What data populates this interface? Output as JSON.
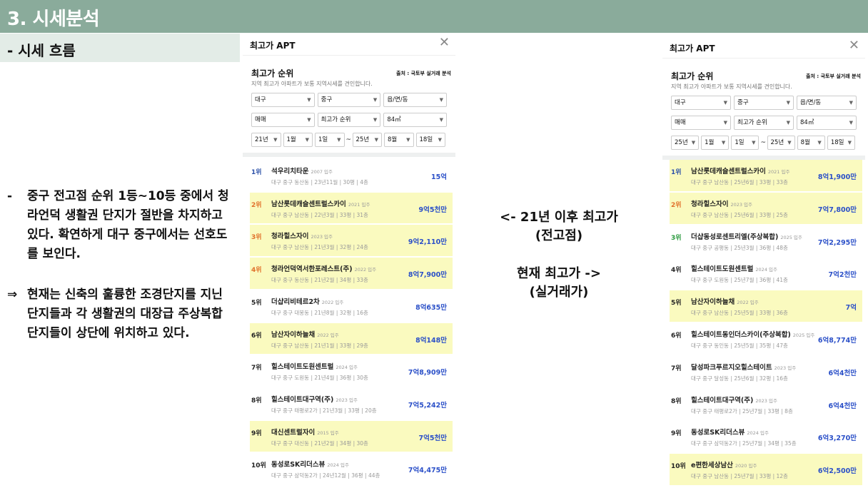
{
  "title": "3. 시세분석",
  "subtitle": "- 시세 흐름",
  "notes": [
    {
      "bullet": "-",
      "text": "중구 전고점 순위 1등~10등 중에서 청라언덕 생활권 단지가 절반을 차지하고 있다. 확연하게 대구 중구에서는 선호도를 보인다."
    },
    {
      "bullet": "⇒",
      "text": "현재는 신축의 훌륭한 조경단지를 지닌 단지들과 각 생활권의 대장급 주상복합 단지들이 상단에 위치하고 있다."
    }
  ],
  "middle": {
    "line1": "<- 21년 이후 최고가",
    "line2": "(전고점)",
    "line3": "현재 최고가 ->",
    "line4": "(실거래가)"
  },
  "panels": [
    {
      "title": "최고가 APT",
      "rank_title": "최고가 순위",
      "source": "출처 : 국토부 실거래 분석",
      "desc": "지역 최고가 아파트가 보통 지역시세를 견인합니다.",
      "filters": {
        "city": "대구",
        "district": "중구",
        "dong": "읍/면/동",
        "deal": "매매",
        "sort": "최고가 순위",
        "size": "84㎡",
        "from_year": "21년",
        "from_month": "1월",
        "from_day": "1일",
        "to_year": "25년",
        "to_month": "8월",
        "to_day": "18일"
      },
      "rows": [
        {
          "rank": "1위",
          "name": "석우리치타운",
          "year": "2007 입주",
          "info": "대구 중구 동산동 | 23년11월 | 30평 | 4층",
          "price": "15억",
          "hl": false
        },
        {
          "rank": "2위",
          "name": "남산롯데캐슬센트럴스카이",
          "year": "2021 입주",
          "info": "대구 중구 남산동 | 22년3월 | 33평 | 31층",
          "price": "9억5천만",
          "hl": true
        },
        {
          "rank": "3위",
          "name": "청라힐스자이",
          "year": "2023 입주",
          "info": "대구 중구 남산동 | 21년3월 | 32평 | 24층",
          "price": "9억2,110만",
          "hl": true
        },
        {
          "rank": "4위",
          "name": "청라언덕역서한포레스트(주)",
          "year": "2022 입주",
          "info": "대구 중구 동산동 | 21년2월 | 34평 | 33층",
          "price": "8억7,900만",
          "hl": true
        },
        {
          "rank": "5위",
          "name": "더샵리비테르2차",
          "year": "2022 입주",
          "info": "대구 중구 대봉동 | 21년8월 | 32평 | 16층",
          "price": "8억635만",
          "hl": false
        },
        {
          "rank": "6위",
          "name": "남산자이하늘채",
          "year": "2022 입주",
          "info": "대구 중구 남산동 | 21년1월 | 33평 | 29층",
          "price": "8억148만",
          "hl": true
        },
        {
          "rank": "7위",
          "name": "힐스테이트도원센트럴",
          "year": "2024 입주",
          "info": "대구 중구 도원동 | 21년4월 | 36평 | 30층",
          "price": "7억8,909만",
          "hl": false
        },
        {
          "rank": "8위",
          "name": "힐스테이트대구역(주)",
          "year": "2023 입주",
          "info": "대구 중구 태평로2가 | 21년3월 | 33평 | 20층",
          "price": "7억5,242만",
          "hl": false
        },
        {
          "rank": "9위",
          "name": "대신센트럴자이",
          "year": "2015 입주",
          "info": "대구 중구 대신동 | 21년2월 | 34평 | 30층",
          "price": "7억5천만",
          "hl": true
        },
        {
          "rank": "10위",
          "name": "동성로SK리더스뷰",
          "year": "2024 입주",
          "info": "대구 중구 삼덕동2가 | 24년12월 | 36평 | 44층",
          "price": "7억4,475만",
          "hl": false
        }
      ]
    },
    {
      "title": "최고가 APT",
      "rank_title": "최고가 순위",
      "source": "출처 : 국토부 실거래 분석",
      "desc": "지역 최고가 아파트가 보통 지역시세를 견인합니다.",
      "filters": {
        "city": "대구",
        "district": "중구",
        "dong": "읍/면/동",
        "deal": "매매",
        "sort": "최고가 순위",
        "size": "84㎡",
        "from_year": "25년",
        "from_month": "1월",
        "from_day": "1일",
        "to_year": "25년",
        "to_month": "8월",
        "to_day": "18일"
      },
      "rows": [
        {
          "rank": "1위",
          "name": "남산롯데캐슬센트럴스카이",
          "year": "2021 입주",
          "info": "대구 중구 남산동 | 25년6월 | 33평 | 33층",
          "price": "8억1,900만",
          "hl": true
        },
        {
          "rank": "2위",
          "name": "청라힐스자이",
          "year": "2023 입주",
          "info": "대구 중구 남산동 | 25년6월 | 33평 | 25층",
          "price": "7억7,800만",
          "hl": true
        },
        {
          "rank": "3위",
          "name": "더샵동성로센트리엘(주상복합)",
          "year": "2025 입주",
          "info": "대구 중구 공평동 | 25년3월 | 36평 | 48층",
          "price": "7억2,295만",
          "hl": false
        },
        {
          "rank": "4위",
          "name": "힐스테이트도원센트럴",
          "year": "2024 입주",
          "info": "대구 중구 도원동 | 25년7월 | 36평 | 41층",
          "price": "7억2천만",
          "hl": false
        },
        {
          "rank": "5위",
          "name": "남산자이하늘채",
          "year": "2022 입주",
          "info": "대구 중구 남산동 | 25년5월 | 33평 | 36층",
          "price": "7억",
          "hl": true
        },
        {
          "rank": "6위",
          "name": "힐스테이트동인더스카이(주상복합)",
          "year": "2025 입주",
          "info": "대구 중구 동인동 | 25년5월 | 35평 | 47층",
          "price": "6억8,774만",
          "hl": false
        },
        {
          "rank": "7위",
          "name": "달성파크푸르지오힐스테이트",
          "year": "2023 입주",
          "info": "대구 중구 달성동 | 25년6월 | 32평 | 16층",
          "price": "6억4천만",
          "hl": false
        },
        {
          "rank": "8위",
          "name": "힐스테이트대구역(주)",
          "year": "2023 입주",
          "info": "대구 중구 태평로2가 | 25년7월 | 33평 | 8층",
          "price": "6억4천만",
          "hl": false
        },
        {
          "rank": "9위",
          "name": "동성로SK리더스뷰",
          "year": "2024 입주",
          "info": "대구 중구 삼덕동2가 | 25년7월 | 34평 | 35층",
          "price": "6억3,270만",
          "hl": false
        },
        {
          "rank": "10위",
          "name": "e편한세상남산",
          "year": "2020 입주",
          "info": "대구 중구 남산동 | 25년7월 | 33평 | 12층",
          "price": "6억2,500만",
          "hl": true
        }
      ]
    }
  ]
}
